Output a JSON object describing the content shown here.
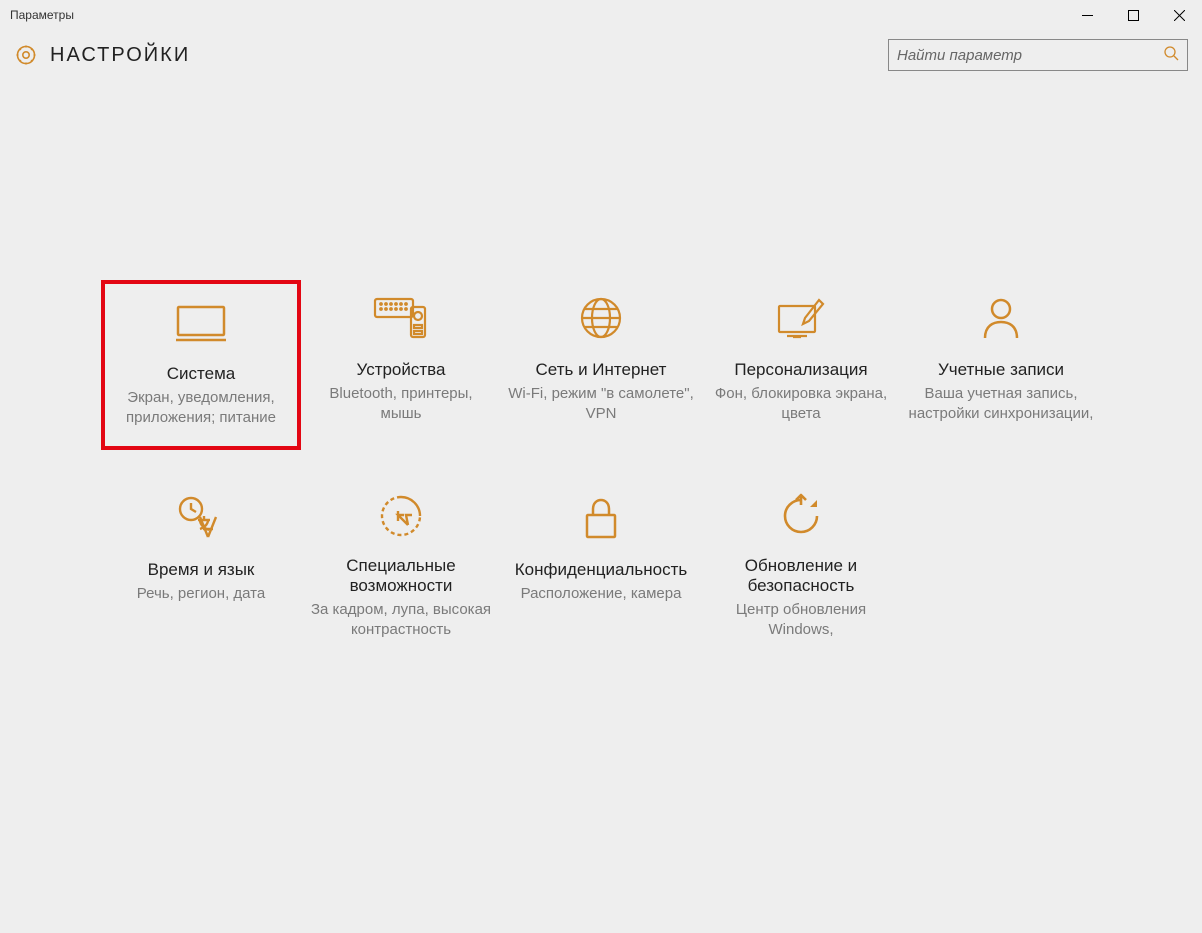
{
  "window": {
    "title": "Параметры"
  },
  "header": {
    "title": "НАСТРОЙКИ"
  },
  "search": {
    "placeholder": "Найти параметр"
  },
  "tiles": [
    {
      "title": "Система",
      "desc": "Экран, уведомления, приложения; питание",
      "highlight": true
    },
    {
      "title": "Устройства",
      "desc": "Bluetooth, принтеры, мышь"
    },
    {
      "title": "Сеть и Интернет",
      "desc": "Wi-Fi, режим \"в самолете\", VPN"
    },
    {
      "title": "Персонализация",
      "desc": "Фон, блокировка экрана, цвета"
    },
    {
      "title": "Учетные записи",
      "desc": "Ваша учетная запись, настройки синхронизации,"
    },
    {
      "title": "Время и язык",
      "desc": "Речь, регион, дата"
    },
    {
      "title": "Специальные возможности",
      "desc": "За кадром, лупа, высокая контрастность"
    },
    {
      "title": "Конфиденциальность",
      "desc": "Расположение, камера"
    },
    {
      "title": "Обновление и безопасность",
      "desc": "Центр обновления Windows,"
    }
  ]
}
